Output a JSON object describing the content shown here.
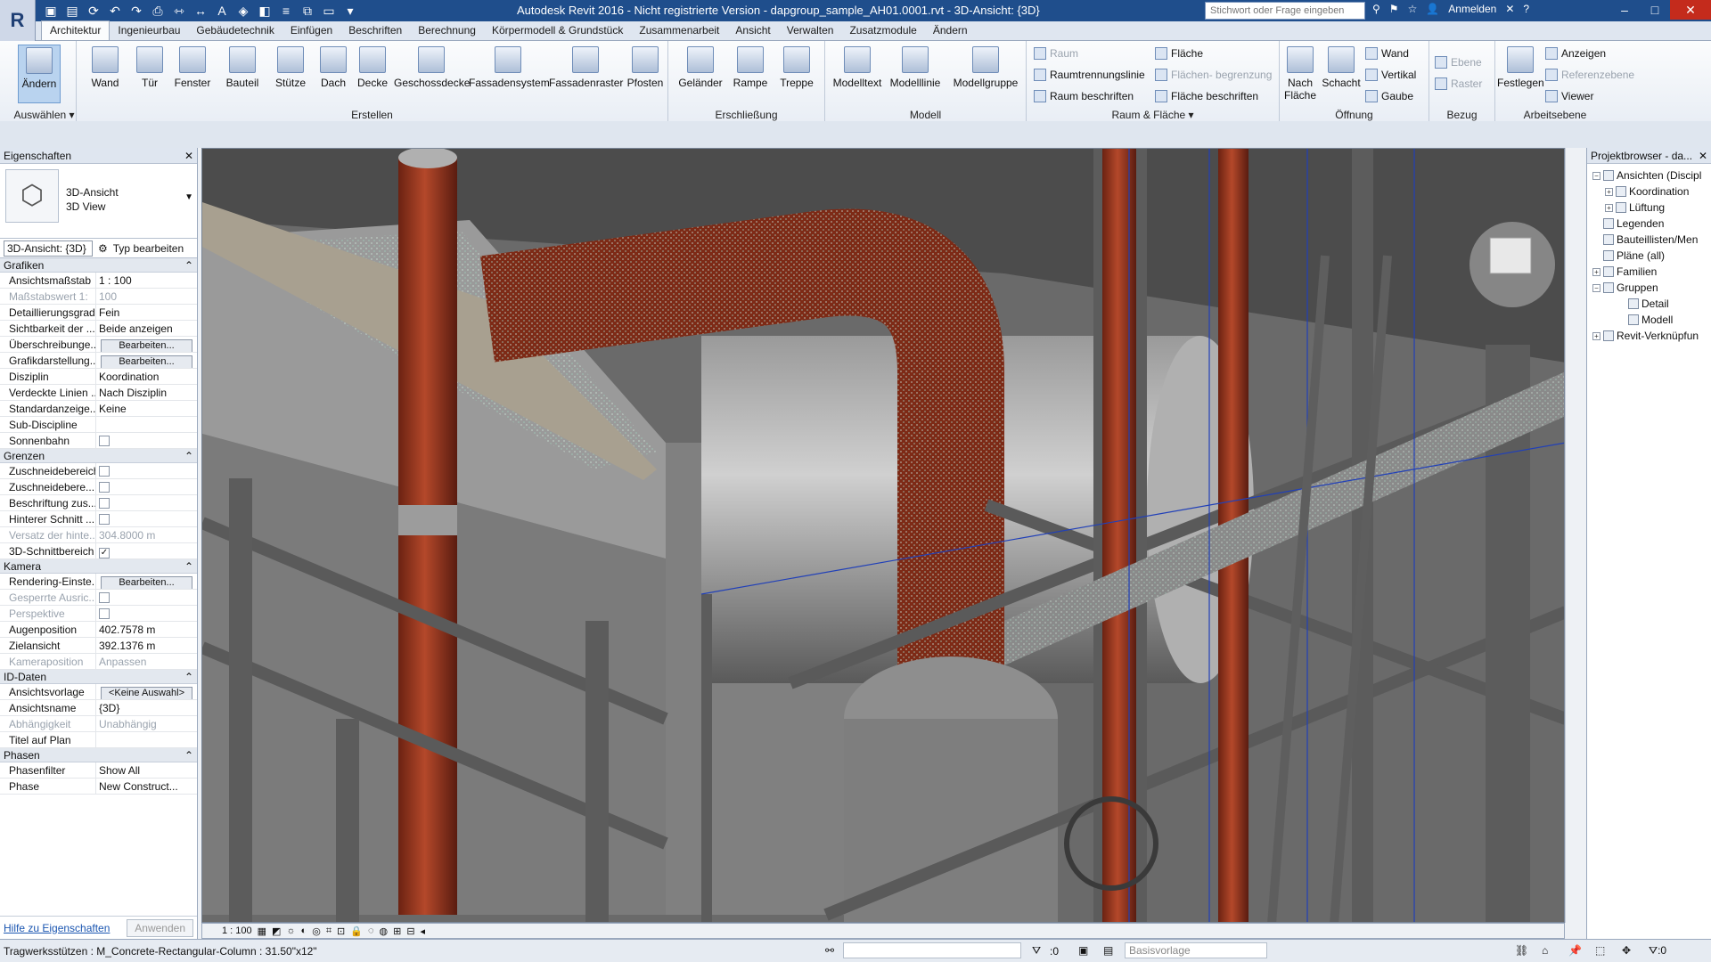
{
  "app": {
    "logo": "R",
    "title": "Autodesk Revit 2016 - Nicht registrierte Version -    dapgroup_sample_AH01.0001.rvt - 3D-Ansicht: {3D}",
    "search_placeholder": "Stichwort oder Frage eingeben",
    "signin": "Anmelden",
    "help": "?"
  },
  "tabs": [
    "Architektur",
    "Ingenieurbau",
    "Gebäudetechnik",
    "Einfügen",
    "Beschriften",
    "Berechnung",
    "Körpermodell & Grundstück",
    "Zusammenarbeit",
    "Ansicht",
    "Verwalten",
    "Zusatzmodule",
    "Ändern"
  ],
  "ribbon": {
    "select": {
      "button": "Ändern",
      "label": "Auswählen ▾"
    },
    "erstellen": {
      "label": "Erstellen",
      "buttons": [
        "Wand",
        "Tür",
        "Fenster",
        "Bauteil",
        "Stütze",
        "Dach",
        "Decke",
        "Geschossdecke",
        "Fassadensystem",
        "Fassadenraster",
        "Pfosten"
      ]
    },
    "erschliessung": {
      "label": "Erschließung",
      "buttons": [
        "Geländer",
        "Rampe",
        "Treppe"
      ]
    },
    "modell": {
      "label": "Modell",
      "buttons": [
        "Modelltext",
        "Modelllinie",
        "Modellgruppe"
      ]
    },
    "raum": {
      "label": "Raum & Fläche ▾",
      "items": [
        "Raum",
        "Raumtrennungslinie",
        "Raum  beschriften",
        "Fläche",
        "Flächen- begrenzung",
        "Fläche  beschriften"
      ]
    },
    "oeffnung": {
      "label": "Öffnung",
      "buttons": [
        "Nach Fläche",
        "Schacht"
      ],
      "items": [
        "Wand",
        "Vertikal",
        "Gaube"
      ]
    },
    "bezug": {
      "label": "Bezug",
      "items": [
        "Ebene",
        "Raster"
      ]
    },
    "arbeitsebene": {
      "label": "Arbeitsebene",
      "button": "Festlegen",
      "items": [
        "Anzeigen",
        "Referenzebene",
        "Viewer"
      ]
    }
  },
  "properties": {
    "title": "Eigenschaften",
    "type_line1": "3D-Ansicht",
    "type_line2": "3D View",
    "instance_select": "3D-Ansicht: {3D}",
    "edit_type": "Typ bearbeiten",
    "sections": [
      {
        "name": "Grafiken",
        "rows": [
          {
            "k": "Ansichtsmaßstab",
            "v": "1 : 100"
          },
          {
            "k": "Maßstabswert 1:",
            "v": "100",
            "dis": true
          },
          {
            "k": "Detaillierungsgrad",
            "v": "Fein"
          },
          {
            "k": "Sichtbarkeit der ...",
            "v": "Beide anzeigen"
          },
          {
            "k": "Überschreibunge...",
            "v": "Bearbeiten...",
            "btn": true
          },
          {
            "k": "Grafikdarstellung...",
            "v": "Bearbeiten...",
            "btn": true
          },
          {
            "k": "Disziplin",
            "v": "Koordination"
          },
          {
            "k": "Verdeckte Linien ...",
            "v": "Nach Disziplin"
          },
          {
            "k": "Standardanzeige...",
            "v": "Keine"
          },
          {
            "k": "Sub-Discipline",
            "v": ""
          },
          {
            "k": "Sonnenbahn",
            "v": "",
            "chk": ""
          }
        ]
      },
      {
        "name": "Grenzen",
        "rows": [
          {
            "k": "Zuschneidebereich",
            "v": "",
            "chk": ""
          },
          {
            "k": "Zuschneidebere...",
            "v": "",
            "chk": ""
          },
          {
            "k": "Beschriftung zus...",
            "v": "",
            "chk": ""
          },
          {
            "k": "Hinterer Schnitt ...",
            "v": "",
            "chk": ""
          },
          {
            "k": "Versatz der hinte...",
            "v": "304.8000 m",
            "dis": true
          },
          {
            "k": "3D-Schnittbereich",
            "v": "",
            "chk": "✓"
          }
        ]
      },
      {
        "name": "Kamera",
        "rows": [
          {
            "k": "Rendering-Einste...",
            "v": "Bearbeiten...",
            "btn": true
          },
          {
            "k": "Gesperrte Ausric...",
            "v": "",
            "chk": "",
            "dis": true
          },
          {
            "k": "Perspektive",
            "v": "",
            "chk": "",
            "dis": true
          },
          {
            "k": "Augenposition",
            "v": "402.7578 m"
          },
          {
            "k": "Zielansicht",
            "v": "392.1376 m"
          },
          {
            "k": "Kameraposition",
            "v": "Anpassen",
            "dis": true
          }
        ]
      },
      {
        "name": "ID-Daten",
        "rows": [
          {
            "k": "Ansichtsvorlage",
            "v": "<Keine Auswahl>",
            "btn": true
          },
          {
            "k": "Ansichtsname",
            "v": "{3D}"
          },
          {
            "k": "Abhängigkeit",
            "v": "Unabhängig",
            "dis": true
          },
          {
            "k": "Titel auf Plan",
            "v": ""
          }
        ]
      },
      {
        "name": "Phasen",
        "rows": [
          {
            "k": "Phasenfilter",
            "v": "Show All"
          },
          {
            "k": "Phase",
            "v": "New Construct..."
          }
        ]
      }
    ],
    "help_link": "Hilfe zu Eigenschaften",
    "apply": "Anwenden"
  },
  "viewbar": {
    "scale": "1 : 100"
  },
  "browser": {
    "title": "Projektbrowser - da...",
    "items": [
      {
        "pm": "−",
        "label": "Ansichten (Discipl",
        "indent": 0
      },
      {
        "pm": "+",
        "label": "Koordination",
        "indent": 1
      },
      {
        "pm": "+",
        "label": "Lüftung",
        "indent": 1
      },
      {
        "pm": "",
        "label": "Legenden",
        "indent": 0
      },
      {
        "pm": "",
        "label": "Bauteillisten/Men",
        "indent": 0
      },
      {
        "pm": "",
        "label": "Pläne (all)",
        "indent": 0
      },
      {
        "pm": "+",
        "label": "Familien",
        "indent": 0
      },
      {
        "pm": "−",
        "label": "Gruppen",
        "indent": 0
      },
      {
        "pm": "",
        "label": "Detail",
        "indent": 2
      },
      {
        "pm": "",
        "label": "Modell",
        "indent": 2
      },
      {
        "pm": "+",
        "label": "Revit-Verknüpfun",
        "indent": 0
      }
    ]
  },
  "status": {
    "text": "Tragwerksstützen : M_Concrete-Rectangular-Column : 31.50\"x12\"",
    "zero": ":0",
    "base": "Basisvorlage"
  },
  "colors": {
    "titlebar": "#1f4e8c",
    "pipe_red": "#a33a1e",
    "viewport_grey": "#6d6d6d"
  }
}
